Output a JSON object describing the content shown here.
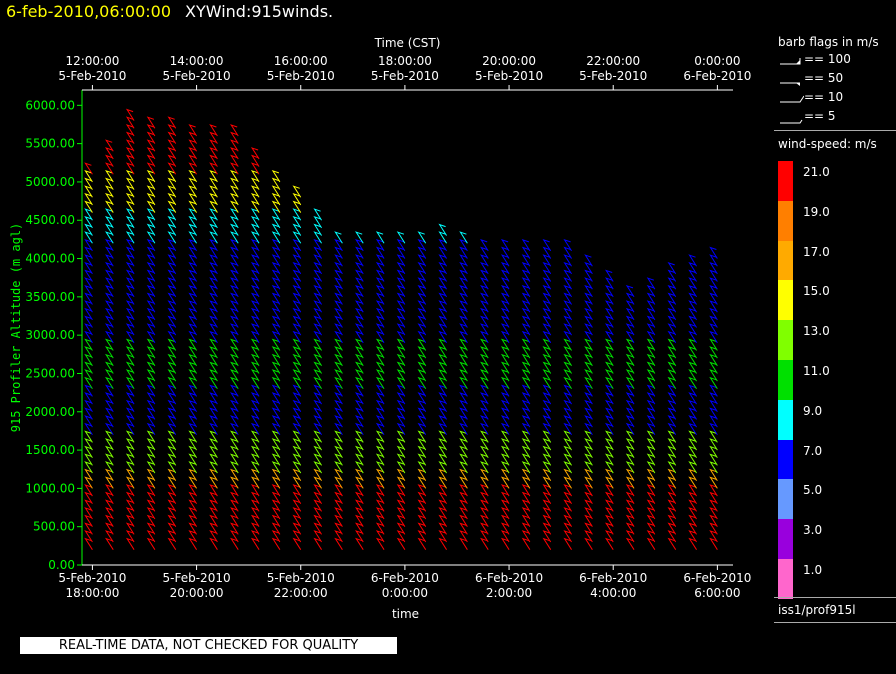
{
  "header": {
    "datetime": "6-feb-2010,06:00:00",
    "title": "XYWind:915winds."
  },
  "qc_notice": "REAL-TIME DATA, NOT CHECKED FOR QUALITY",
  "barb_legend": {
    "title": "barb flags in m/s",
    "items": [
      {
        "label": "== 100",
        "value": 100
      },
      {
        "label": "== 50",
        "value": 50
      },
      {
        "label": "== 10",
        "value": 10
      },
      {
        "label": "== 5",
        "value": 5
      }
    ]
  },
  "speed_legend": {
    "title": "wind-speed: m/s",
    "entries": [
      {
        "label": "21.0",
        "color": "#ff0000"
      },
      {
        "label": "19.0",
        "color": "#ff7f00"
      },
      {
        "label": "17.0",
        "color": "#ffaa00"
      },
      {
        "label": "15.0",
        "color": "#ffff00"
      },
      {
        "label": "13.0",
        "color": "#80ff00"
      },
      {
        "label": "11.0",
        "color": "#00e000"
      },
      {
        "label": "9.0",
        "color": "#00ffff"
      },
      {
        "label": "7.0",
        "color": "#0000ff"
      },
      {
        "label": "5.0",
        "color": "#6699ff"
      },
      {
        "label": "3.0",
        "color": "#9900dd"
      },
      {
        "label": "1.0",
        "color": "#ff66cc"
      }
    ]
  },
  "source": "iss1/prof915l",
  "chart_data": {
    "type": "wind-barb time-height",
    "ylabel": "915 Profiler Altitude (m agl)",
    "ylim": [
      0,
      6200
    ],
    "yticks": [
      "0.00",
      "500.00",
      "1000.00",
      "1500.00",
      "2000.00",
      "2500.00",
      "3000.00",
      "3500.00",
      "4000.00",
      "4500.00",
      "5000.00",
      "5500.00",
      "6000.00"
    ],
    "xlabel_bottom": "time",
    "xticks_bottom": [
      {
        "date": "5-Feb-2010",
        "time": "18:00:00"
      },
      {
        "date": "5-Feb-2010",
        "time": "20:00:00"
      },
      {
        "date": "5-Feb-2010",
        "time": "22:00:00"
      },
      {
        "date": "6-Feb-2010",
        "time": "0:00:00"
      },
      {
        "date": "6-Feb-2010",
        "time": "2:00:00"
      },
      {
        "date": "6-Feb-2010",
        "time": "4:00:00"
      },
      {
        "date": "6-Feb-2010",
        "time": "6:00:00"
      }
    ],
    "xlabel_top": "Time (CST)",
    "xticks_top": [
      {
        "time": "12:00:00",
        "date": "5-Feb-2010"
      },
      {
        "time": "14:00:00",
        "date": "5-Feb-2010"
      },
      {
        "time": "16:00:00",
        "date": "5-Feb-2010"
      },
      {
        "time": "18:00:00",
        "date": "5-Feb-2010"
      },
      {
        "time": "20:00:00",
        "date": "5-Feb-2010"
      },
      {
        "time": "22:00:00",
        "date": "5-Feb-2010"
      },
      {
        "time": "0:00:00",
        "date": "6-Feb-2010"
      }
    ],
    "hours_range": [
      -0.1,
      6.15
    ],
    "profile_interval_hours": 0.2,
    "altitude_step_m": 100,
    "grid": false,
    "speed_colors": [
      {
        "min": 20,
        "color": "#ff0000"
      },
      {
        "min": 18,
        "color": "#ff7f00"
      },
      {
        "min": 16,
        "color": "#ffaa00"
      },
      {
        "min": 14,
        "color": "#ffff00"
      },
      {
        "min": 12,
        "color": "#80ff00"
      },
      {
        "min": 10,
        "color": "#00e000"
      },
      {
        "min": 8,
        "color": "#00ffff"
      },
      {
        "min": 6,
        "color": "#0000ff"
      },
      {
        "min": 4,
        "color": "#6699ff"
      },
      {
        "min": 2,
        "color": "#9900dd"
      },
      {
        "min": 0,
        "color": "#ff66cc"
      }
    ],
    "speed_layers": [
      {
        "from": 200,
        "to": 1000,
        "speed": 21
      },
      {
        "from": 1000,
        "to": 1200,
        "speed": 17
      },
      {
        "from": 1200,
        "to": 1700,
        "speed": 12
      },
      {
        "from": 1700,
        "to": 2300,
        "speed": 7
      },
      {
        "from": 2300,
        "to": 2900,
        "speed": 11
      },
      {
        "from": 2900,
        "to": 3700,
        "speed": 7
      },
      {
        "from": 3700,
        "to": 4200,
        "speed": 7
      },
      {
        "from": 4200,
        "to": 4600,
        "speed": 9
      },
      {
        "from": 4600,
        "to": 5100,
        "speed": 15
      },
      {
        "from": 5100,
        "to": 5900,
        "speed": 21
      }
    ],
    "top_altitude_by_hour": [
      {
        "hour": 0.0,
        "top": 5100
      },
      {
        "hour": 0.4,
        "top": 5800
      },
      {
        "hour": 1.4,
        "top": 5600
      },
      {
        "hour": 2.0,
        "top": 4800
      },
      {
        "hour": 2.4,
        "top": 4200
      },
      {
        "hour": 3.4,
        "top": 4300
      },
      {
        "hour": 4.0,
        "top": 4100
      },
      {
        "hour": 4.6,
        "top": 4200
      },
      {
        "hour": 5.2,
        "top": 3500
      },
      {
        "hour": 5.6,
        "top": 3800
      },
      {
        "hour": 6.0,
        "top": 4000
      }
    ]
  }
}
